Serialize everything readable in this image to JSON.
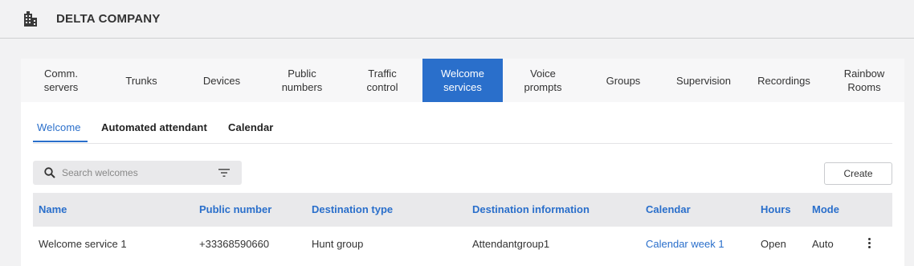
{
  "header": {
    "company": "DELTA COMPANY",
    "icon": "building-icon"
  },
  "nav": {
    "tabs": [
      {
        "label": "Comm.\nservers",
        "active": false
      },
      {
        "label": "Trunks",
        "active": false
      },
      {
        "label": "Devices",
        "active": false
      },
      {
        "label": "Public\nnumbers",
        "active": false
      },
      {
        "label": "Traffic\ncontrol",
        "active": false
      },
      {
        "label": "Welcome\nservices",
        "active": true
      },
      {
        "label": "Voice\nprompts",
        "active": false
      },
      {
        "label": "Groups",
        "active": false
      },
      {
        "label": "Supervision",
        "active": false
      },
      {
        "label": "Recordings",
        "active": false
      },
      {
        "label": "Rainbow\nRooms",
        "active": false
      }
    ]
  },
  "subtabs": {
    "items": [
      {
        "label": "Welcome",
        "active": true
      },
      {
        "label": "Automated attendant",
        "active": false
      },
      {
        "label": "Calendar",
        "active": false
      }
    ]
  },
  "toolbar": {
    "search_placeholder": "Search welcomes",
    "create_label": "Create"
  },
  "table": {
    "columns": [
      "Name",
      "Public number",
      "Destination type",
      "Destination information",
      "Calendar",
      "Hours",
      "Mode"
    ],
    "rows": [
      [
        "Welcome service 1",
        "+33368590660",
        "Hunt group",
        "Attendantgroup1",
        "Calendar week 1",
        "Open",
        "Auto"
      ]
    ]
  },
  "colors": {
    "accent": "#2a6fcb",
    "header_bg": "#f2f2f3",
    "table_head_bg": "#e9e9eb"
  }
}
